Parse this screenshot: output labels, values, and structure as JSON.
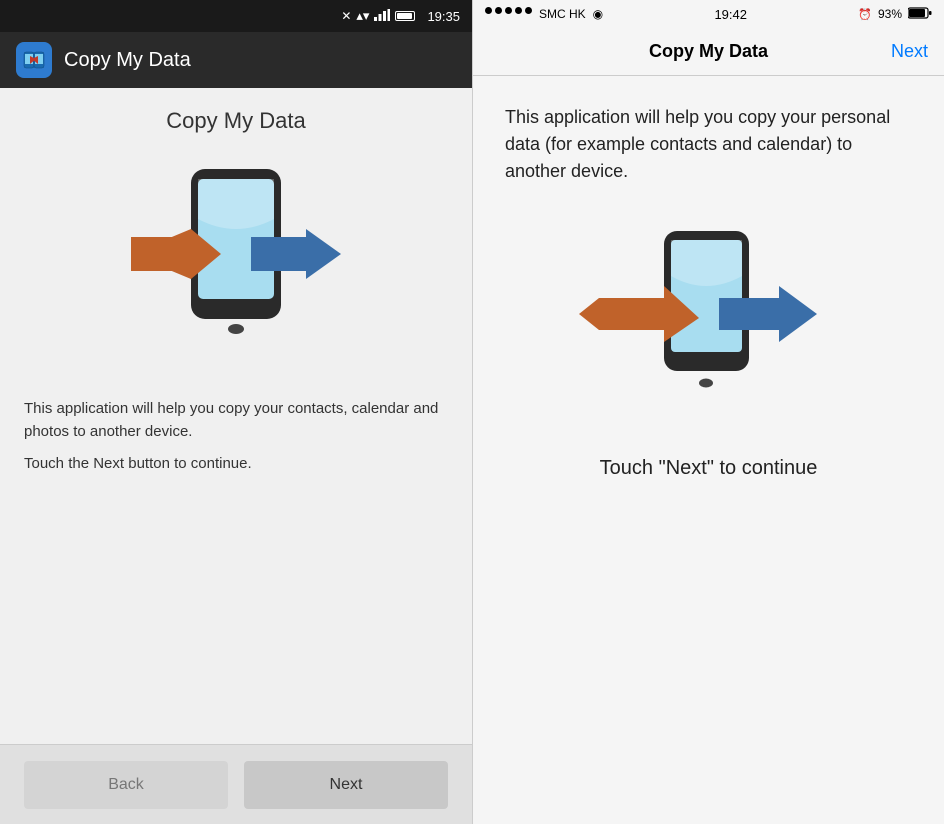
{
  "android": {
    "statusbar": {
      "time": "19:35",
      "battery": "96"
    },
    "topbar": {
      "app_title": "Copy My Data"
    },
    "content": {
      "page_title": "Copy My Data",
      "description": "This application will help you copy your contacts, calendar and photos to another device.",
      "hint": "Touch the Next button to continue."
    },
    "buttons": {
      "back_label": "Back",
      "next_label": "Next"
    }
  },
  "ios": {
    "statusbar": {
      "carrier": "SMC HK",
      "time": "19:42",
      "battery": "93%"
    },
    "navbar": {
      "title": "Copy My Data",
      "next_label": "Next"
    },
    "content": {
      "description": "This application will help you copy your personal data (for example contacts and calendar) to another device.",
      "hint": "Touch \"Next\" to continue"
    }
  }
}
